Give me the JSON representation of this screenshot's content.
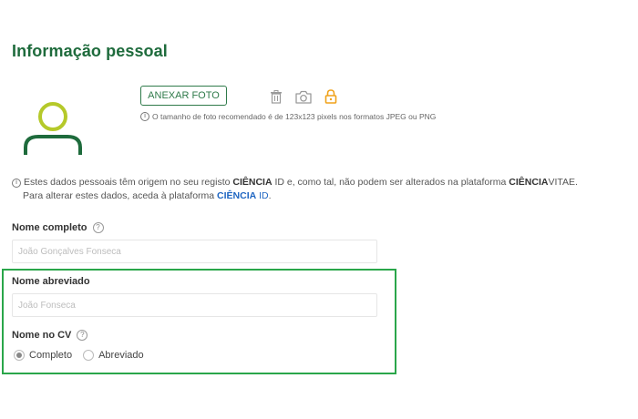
{
  "page": {
    "title": "Informação pessoal"
  },
  "photo": {
    "attach_label": "ANEXAR FOTO",
    "hint": "O tamanho de foto recomendado é de 123x123 pixels nos formatos JPEG ou PNG",
    "icons": [
      "trash-icon",
      "camera-icon",
      "lock-icon"
    ]
  },
  "notice": {
    "line1_a": "Estes dados pessoais têm origem no seu registo ",
    "line1_b": "CIÊNCIA",
    "line1_c": " ID e, como tal, não podem ser alterados na plataforma ",
    "line1_d": "CIÊNCIA",
    "line1_e": "VITAE.",
    "line2_a": "Para alterar estes dados, aceda à plataforma ",
    "line2_link_bold": "CIÊNCIA",
    "line2_link_rest": " ID",
    "line2_end": "."
  },
  "fields": {
    "full_name": {
      "label": "Nome completo",
      "placeholder": "João Gonçalves Fonseca"
    },
    "short_name": {
      "label": "Nome abreviado",
      "placeholder": "João Fonseca"
    },
    "cv_name": {
      "label": "Nome no CV",
      "options": [
        "Completo",
        "Abreviado"
      ],
      "selected": "Completo"
    }
  },
  "colors": {
    "title": "#1e6b3c",
    "avatar_head": "#b5c92a",
    "avatar_body": "#1e6b3c",
    "lock": "#f0a21a",
    "highlight": "#2aa64a",
    "link": "#1f66c2"
  }
}
